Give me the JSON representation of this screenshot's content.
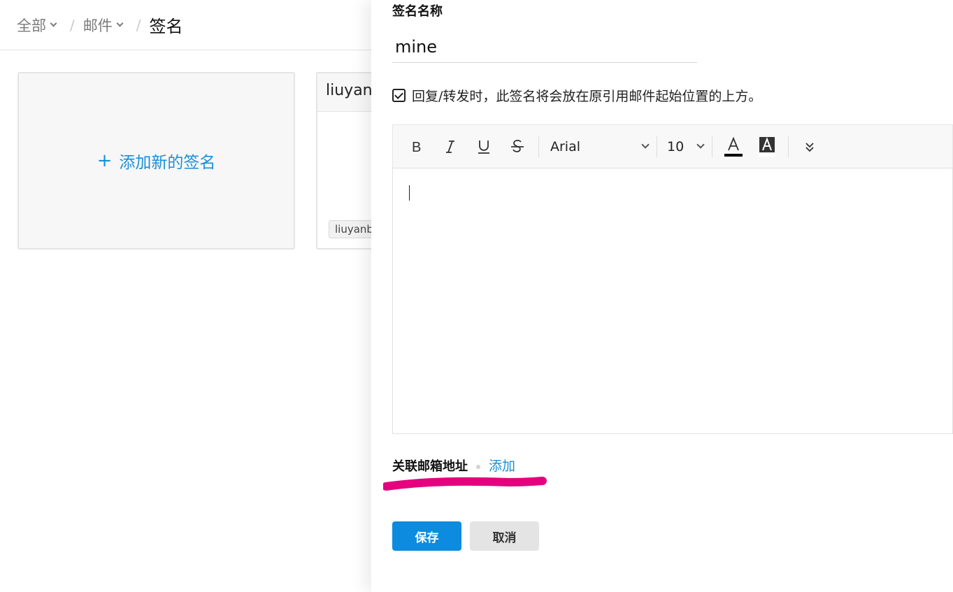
{
  "breadcrumb": {
    "all": "全部",
    "mail": "邮件",
    "current": "签名"
  },
  "cards": {
    "add_label": "添加新的签名",
    "add_icon": "plus-icon",
    "existing_title": "liuyan",
    "existing_tag": "liuyanb"
  },
  "editor_panel": {
    "name_label": "签名名称",
    "name_value": "mine",
    "reply_forward_option": "回复/转发时，此签名将会放在原引用邮件起始位置的上方。",
    "reply_forward_checked": true,
    "toolbar": {
      "font_family": "Arial",
      "font_size": "10",
      "icons": [
        "bold-icon",
        "italic-icon",
        "underline-icon",
        "strikethrough-icon",
        "text-color-icon",
        "background-color-icon",
        "more-icon"
      ]
    },
    "body": "",
    "assoc_label": "关联邮箱地址",
    "assoc_add": "添加",
    "save_label": "保存",
    "cancel_label": "取消"
  },
  "colors": {
    "accent": "#1a8fd8",
    "save_button": "#0d8bde",
    "cancel_button": "#e4e4e4",
    "annotation_highlight": "#e6007e"
  }
}
